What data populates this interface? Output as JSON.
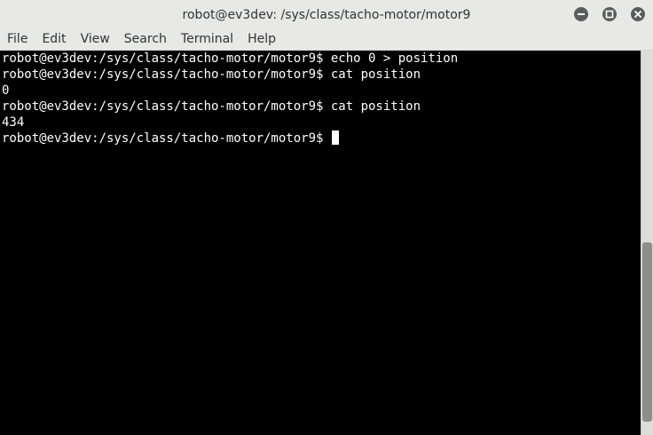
{
  "window": {
    "title": "robot@ev3dev: /sys/class/tacho-motor/motor9"
  },
  "window_buttons": {
    "minimize_icon": "minimize-icon",
    "maximize_icon": "maximize-icon",
    "close_icon": "close-icon"
  },
  "menu": {
    "items": [
      "File",
      "Edit",
      "View",
      "Search",
      "Terminal",
      "Help"
    ]
  },
  "terminal": {
    "lines": [
      "robot@ev3dev:/sys/class/tacho-motor/motor9$ echo 0 > position",
      "robot@ev3dev:/sys/class/tacho-motor/motor9$ cat position",
      "0",
      "robot@ev3dev:/sys/class/tacho-motor/motor9$ cat position",
      "434",
      "robot@ev3dev:/sys/class/tacho-motor/motor9$ "
    ]
  },
  "colors": {
    "background": "#000000",
    "foreground": "#ffffff",
    "chrome": "#e8e8e7"
  }
}
